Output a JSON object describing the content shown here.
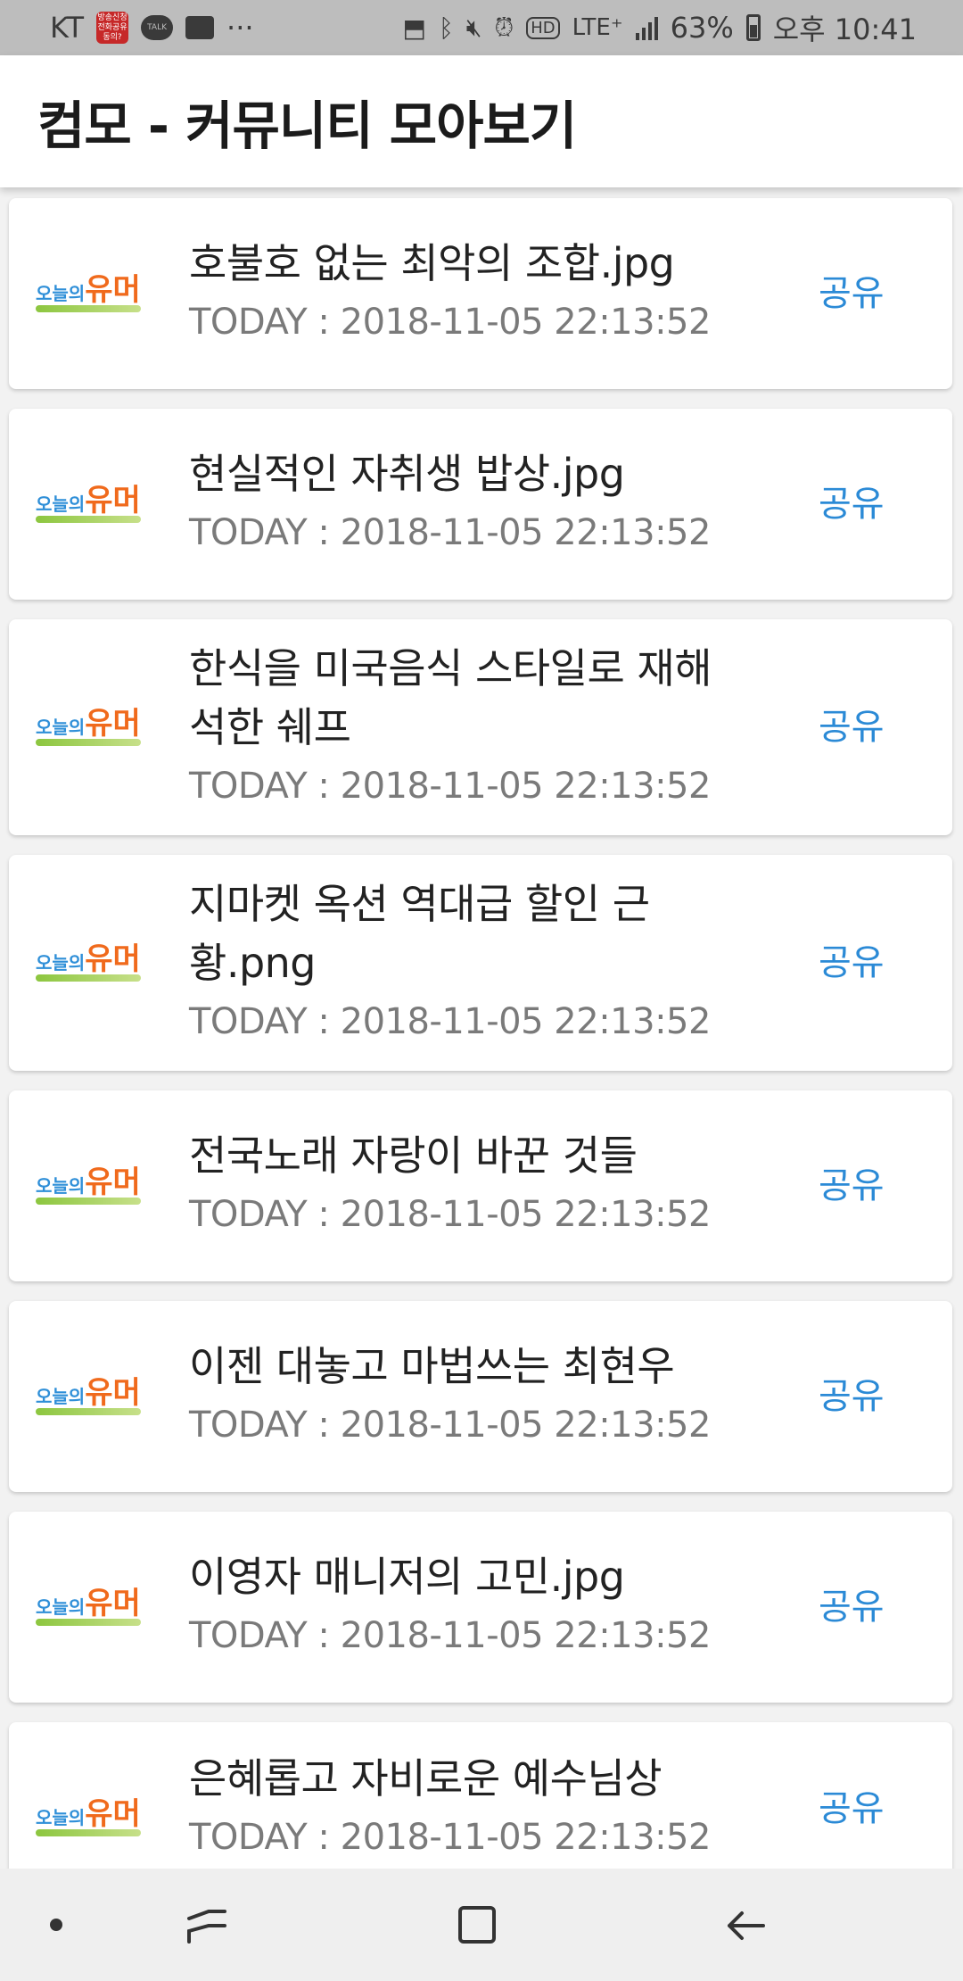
{
  "status_bar": {
    "carrier": "KT",
    "badge_text": "방송신청 전화공유 동의?",
    "talk_label": "TALK",
    "more": "···",
    "network": "LTE⁺",
    "battery": "63%",
    "time": "오후 10:41"
  },
  "app_bar": {
    "title": "컴모 - 커뮤니티 모아보기"
  },
  "logo": {
    "small": "오늘의",
    "big": "유머"
  },
  "list": {
    "share_label": "공유",
    "items": [
      {
        "title": "호불호 없는 최악의 조합.jpg",
        "date": "TODAY : 2018-11-05 22:13:52"
      },
      {
        "title": "현실적인 자취생 밥상.jpg",
        "date": "TODAY : 2018-11-05 22:13:52"
      },
      {
        "title": "한식을 미국음식 스타일로 재해석한 쉐프",
        "date": "TODAY : 2018-11-05 22:13:52"
      },
      {
        "title": "지마켓 옥션 역대급 할인 근황.png",
        "date": "TODAY : 2018-11-05 22:13:52"
      },
      {
        "title": "전국노래 자랑이 바꾼 것들",
        "date": "TODAY : 2018-11-05 22:13:52"
      },
      {
        "title": "이젠 대놓고 마법쓰는 최현우",
        "date": "TODAY : 2018-11-05 22:13:52"
      },
      {
        "title": "이영자 매니저의 고민.jpg",
        "date": "TODAY : 2018-11-05 22:13:52"
      },
      {
        "title": "은혜롭고 자비로운 예수님상",
        "date": "TODAY : 2018-11-05 22:13:52"
      }
    ]
  }
}
